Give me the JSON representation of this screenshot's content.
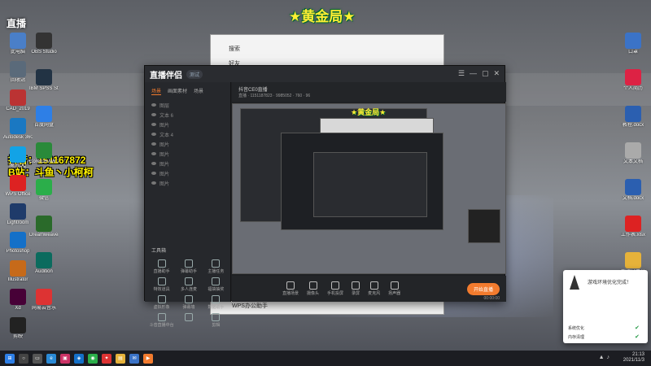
{
  "overlay": {
    "title": "★黄金局★",
    "top_left_logo": "直播",
    "streamer_id_1": "抖音：151167872",
    "streamer_id_2": "B站：斗鱼丶小柯柯"
  },
  "desktop_icons_left": [
    {
      "label": "此电脑",
      "color": "#4a7fc8"
    },
    {
      "label": "回收站",
      "color": "#5a6a7a"
    },
    {
      "label": "CAD_2019",
      "color": "#b33"
    },
    {
      "label": "Autodesk 360",
      "color": "#1a78c2"
    },
    {
      "label": "腾讯QQ",
      "color": "#12a3e6"
    },
    {
      "label": "WPS Office",
      "color": "#d22"
    },
    {
      "label": "Lightroom",
      "color": "#1f3b6a"
    },
    {
      "label": "Photoshop",
      "color": "#1470c8"
    },
    {
      "label": "Illustrator",
      "color": "#c66a1a"
    },
    {
      "label": "Xd",
      "color": "#470137"
    },
    {
      "label": "剪映",
      "color": "#222"
    }
  ],
  "desktop_icons_col2": [
    {
      "label": "OBS Studio",
      "color": "#333"
    },
    {
      "label": "IBM SPSS Statistics 21",
      "color": "#234"
    },
    {
      "label": "百度网盘",
      "color": "#2e7fe6"
    },
    {
      "label": "CorelDRAW 2020",
      "color": "#2a8a3a"
    },
    {
      "label": "微信",
      "color": "#2bae4a"
    },
    {
      "label": "Dreamweaver",
      "color": "#2a6a2a"
    },
    {
      "label": "Audition",
      "color": "#0b6b5e"
    },
    {
      "label": "网易云音乐",
      "color": "#d33"
    }
  ],
  "desktop_icons_right": [
    {
      "label": "口罩",
      "color": "#3b73c7"
    },
    {
      "label": "个人简历",
      "color": "#d24"
    },
    {
      "label": "教程.docx",
      "color": "#2b5fb0"
    },
    {
      "label": "文本文档",
      "color": "#aaa"
    },
    {
      "label": "文档.docx",
      "color": "#2b5fb0"
    },
    {
      "label": "工作表.xlsx",
      "color": "#d22"
    },
    {
      "label": "新建文件夹",
      "color": "#e6b23a"
    }
  ],
  "app": {
    "name": "直播伴侣",
    "version_badge": "测试",
    "source_tabs": [
      "场景",
      "画面素材",
      "场景"
    ],
    "source_items": [
      "图层",
      "文本 6",
      "图片",
      "文本 4",
      "图片",
      "图片",
      "图片",
      "图片",
      "图片"
    ],
    "tools_title": "工具箱",
    "tools": [
      "直播助手",
      "弹幕助手",
      "主播任务",
      "特效道具",
      "多人连麦",
      "福袋抽奖",
      "虚拟形象",
      "弹幕墙",
      "数据助手",
      "斗音直播中台",
      "",
      "剪辑"
    ],
    "preview_title": "抖音CE0直播",
    "preview_status": "直播 · 1151187823 · 9985052 · 760 · 96",
    "preview_overlay": "★黄金局★",
    "controls": [
      "直播场景",
      "摄像头",
      "手机投屏",
      "录屏",
      "麦克风",
      "扬声器"
    ],
    "live_button": "开始直播",
    "timer": "00:00:00"
  },
  "bg_window": {
    "search_label": "搜索",
    "list_header": "好友",
    "footer_item": "WPS办公助手"
  },
  "notification": {
    "title": "游戏环境优化完成！",
    "rows": [
      "系统优化",
      "内存清理"
    ]
  },
  "taskbar": {
    "time": "21:13",
    "date": "2021/11/3",
    "apps": [
      "⊞",
      "○",
      "▭",
      "e",
      "▣",
      "◈",
      "◉",
      "✦",
      "▤",
      "✉",
      "▶"
    ]
  }
}
